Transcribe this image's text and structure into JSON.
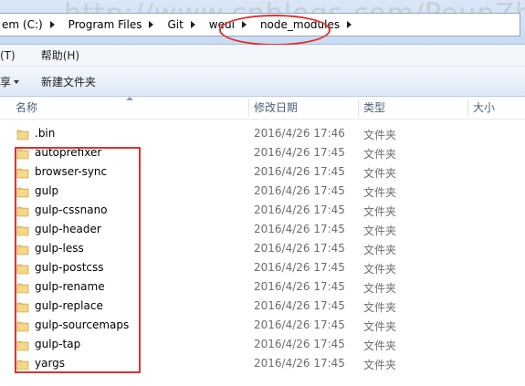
{
  "address": {
    "crumbs": [
      "em (C:)",
      "Program Files",
      "Git",
      "weui",
      "node_modules"
    ],
    "watermark": "http://www.cnblogs.com/PeunZhang/"
  },
  "menu": {
    "items": [
      "(T)",
      "帮助(H)"
    ]
  },
  "toolbar": {
    "share_label": "享",
    "new_folder_label": "新建文件夹"
  },
  "columns": {
    "name": "名称",
    "modified": "修改日期",
    "type": "类型",
    "size": "大小"
  },
  "files": [
    {
      "name": ".bin",
      "modified": "2016/4/26 17:46",
      "type": "文件夹"
    },
    {
      "name": "autoprefixer",
      "modified": "2016/4/26 17:45",
      "type": "文件夹"
    },
    {
      "name": "browser-sync",
      "modified": "2016/4/26 17:45",
      "type": "文件夹"
    },
    {
      "name": "gulp",
      "modified": "2016/4/26 17:45",
      "type": "文件夹"
    },
    {
      "name": "gulp-cssnano",
      "modified": "2016/4/26 17:45",
      "type": "文件夹"
    },
    {
      "name": "gulp-header",
      "modified": "2016/4/26 17:45",
      "type": "文件夹"
    },
    {
      "name": "gulp-less",
      "modified": "2016/4/26 17:45",
      "type": "文件夹"
    },
    {
      "name": "gulp-postcss",
      "modified": "2016/4/26 17:45",
      "type": "文件夹"
    },
    {
      "name": "gulp-rename",
      "modified": "2016/4/26 17:45",
      "type": "文件夹"
    },
    {
      "name": "gulp-replace",
      "modified": "2016/4/26 17:45",
      "type": "文件夹"
    },
    {
      "name": "gulp-sourcemaps",
      "modified": "2016/4/26 17:45",
      "type": "文件夹"
    },
    {
      "name": "gulp-tap",
      "modified": "2016/4/26 17:45",
      "type": "文件夹"
    },
    {
      "name": "yargs",
      "modified": "2016/4/26 17:45",
      "type": "文件夹"
    }
  ],
  "colors": {
    "annotation": "#e0312e",
    "folder": "#e9c46a"
  }
}
